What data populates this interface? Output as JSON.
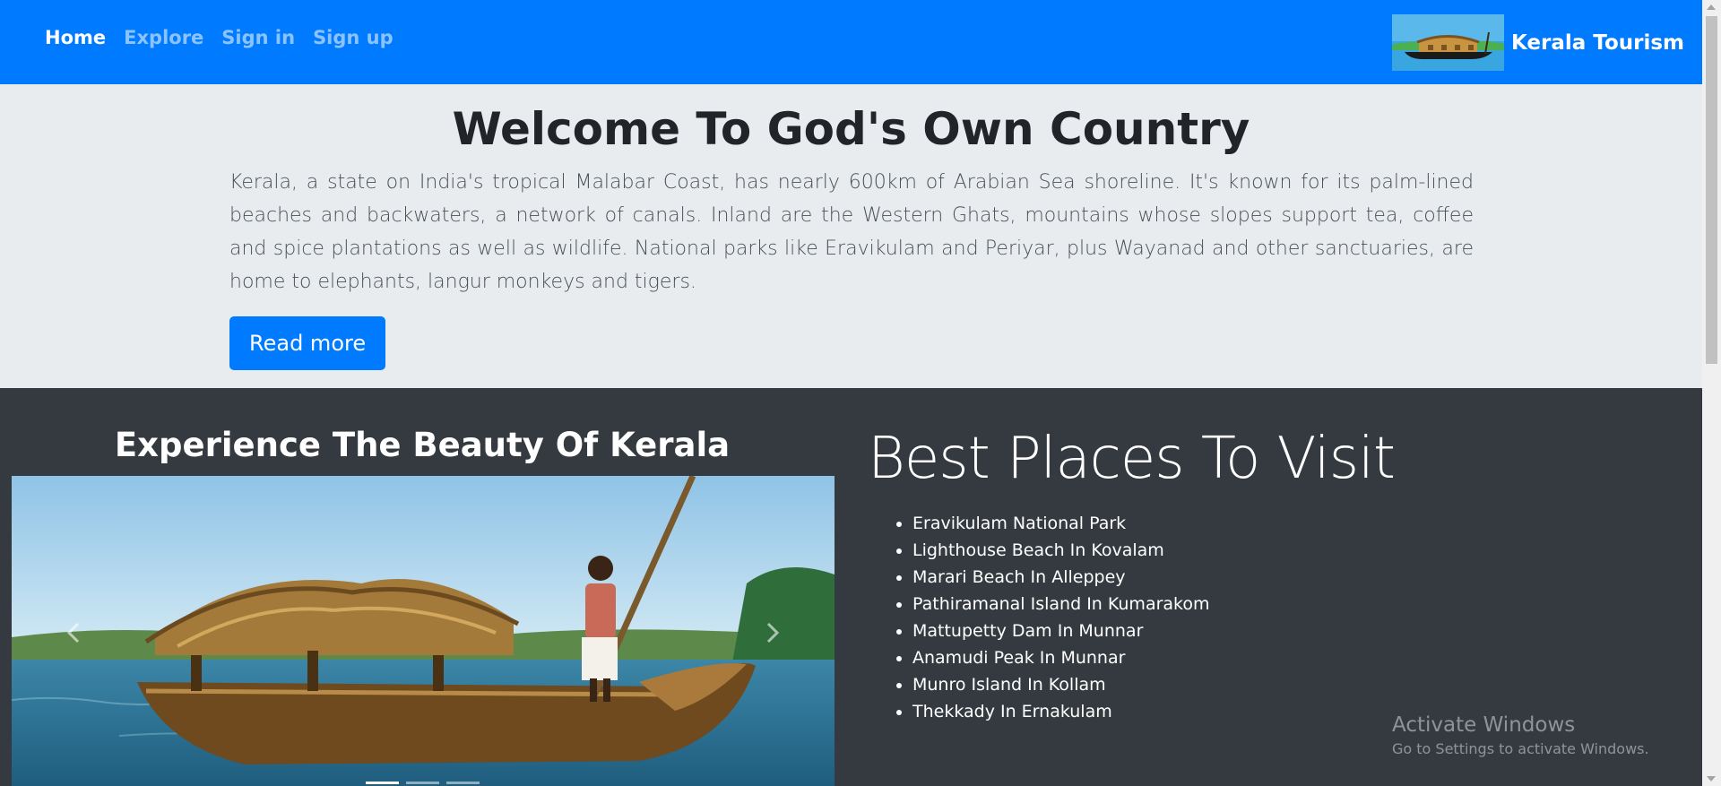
{
  "navbar": {
    "links": [
      {
        "label": "Home",
        "active": true
      },
      {
        "label": "Explore",
        "active": false
      },
      {
        "label": "Sign in",
        "active": false
      },
      {
        "label": "Sign up",
        "active": false
      }
    ],
    "brand": "Kerala Tourism",
    "color": "#007bff"
  },
  "jumbotron": {
    "title": "Welcome To God's Own Country",
    "text": "Kerala, a state on India's tropical Malabar Coast, has nearly 600km of Arabian Sea shoreline. It's known for its palm-lined beaches and backwaters, a network of canals. Inland are the Western Ghats, mountains whose slopes support tea, coffee and spice plantations as well as wildlife. National parks like Eravikulam and Periyar, plus Wayanad and other sanctuaries, are home to elephants, langur monkeys and tigers.",
    "button": "Read more"
  },
  "experience": {
    "title": "Experience The Beauty Of Kerala",
    "carousel": {
      "slides": 3,
      "active_slide": 1
    }
  },
  "places": {
    "title": "Best Places To Visit",
    "items": [
      "Eravikulam National Park",
      "Lighthouse Beach In Kovalam",
      "Marari Beach In Alleppey",
      "Pathiramanal Island In Kumarakom",
      "Mattupetty Dam In Munnar",
      "Anamudi Peak In Munnar",
      "Munro Island In Kollam",
      "Thekkady In Ernakulam"
    ]
  },
  "watermark": {
    "title": "Activate Windows",
    "subtitle": "Go to Settings to activate Windows."
  },
  "colors": {
    "primary": "#007bff",
    "jumbotron_bg": "#e9ecef",
    "dark_bg": "#343a40"
  }
}
